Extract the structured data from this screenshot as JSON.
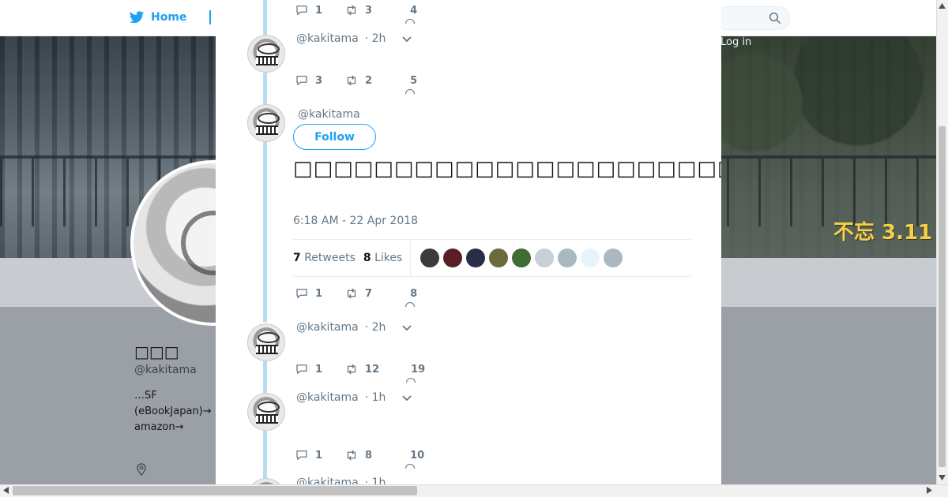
{
  "header": {
    "home_label": "Home",
    "login_label": "Log in"
  },
  "banner": {
    "stamp_text": "不忘 3.11"
  },
  "profile": {
    "name": "□□□",
    "handle": "@kakitama",
    "bio_lines": [
      "…SF",
      "(eBookJapan)→",
      "amazon→"
    ]
  },
  "thread": [
    {
      "id": "t0",
      "handle": "",
      "time": "",
      "replies": "1",
      "retweets": "3",
      "likes": "4"
    },
    {
      "id": "t1",
      "handle": "@kakitama",
      "time": "· 2h",
      "replies": "3",
      "retweets": "2",
      "likes": "5"
    },
    {
      "id": "t3",
      "handle": "@kakitama",
      "time": "· 2h",
      "replies": "1",
      "retweets": "12",
      "likes": "19"
    },
    {
      "id": "t4",
      "handle": "@kakitama",
      "time": "· 1h",
      "replies": "1",
      "retweets": "8",
      "likes": "10"
    },
    {
      "id": "t5",
      "handle": "@kakitama",
      "time": "· 1h"
    }
  ],
  "focused": {
    "handle": "@kakitama",
    "follow_label": "Follow",
    "text": "□□□□□□□□□□□□□□□□□□□□□□□□□□□□□□□□□□□□□□□□□□□□□□□□□□□□□",
    "timestamp": "6:18 AM - 22 Apr 2018",
    "retweets_count": "7",
    "retweets_label": "Retweets",
    "likes_count": "8",
    "likes_label": "Likes",
    "replies": "1",
    "retweets": "7",
    "likes": "8",
    "liker_colors": [
      "#3b3b3b",
      "#5a1f24",
      "#2a2d4a",
      "#6b6a3a",
      "#3f6b34",
      "#c9cfd6",
      "#aab8c2",
      "#e8f4fb",
      "#aab8c2"
    ]
  },
  "colors": {
    "accent": "#1da1f2",
    "thread_line": "#b6dcf2",
    "muted": "#657786"
  }
}
